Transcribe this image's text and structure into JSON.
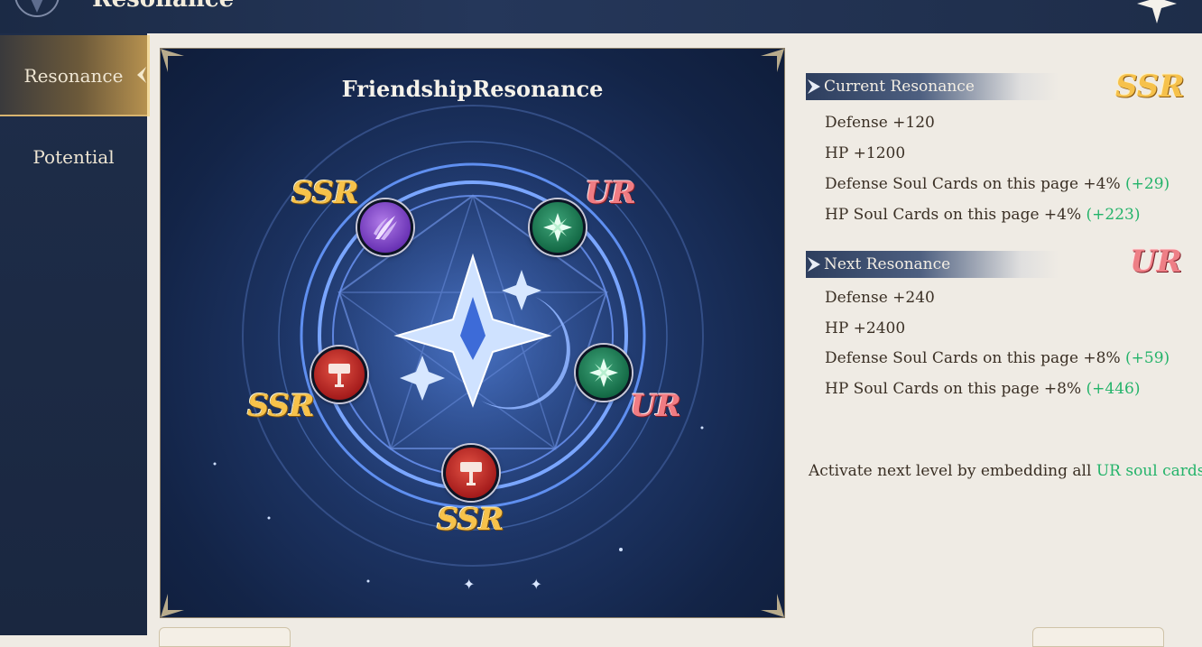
{
  "header": {
    "title": "Resonance",
    "close_icon": "star-close-icon"
  },
  "sidebar": {
    "items": [
      {
        "label": "Resonance",
        "active": true
      },
      {
        "label": "Potential",
        "active": false
      }
    ]
  },
  "card": {
    "title": "FriendshipResonance",
    "nodes": [
      {
        "rank": "SSR",
        "icon": "claw-icon",
        "color": "purple"
      },
      {
        "rank": "UR",
        "icon": "compass-star-icon",
        "color": "green"
      },
      {
        "rank": "UR",
        "icon": "compass-star-icon",
        "color": "green"
      },
      {
        "rank": "SSR",
        "icon": "hammer-icon",
        "color": "red"
      },
      {
        "rank": "SSR",
        "icon": "hammer-icon",
        "color": "red"
      }
    ],
    "page_dots": "✦ ✦"
  },
  "current": {
    "label": "Current Resonance",
    "rank": "SSR",
    "stats": [
      {
        "text": "Defense +120",
        "bonus": ""
      },
      {
        "text": "HP +1200",
        "bonus": ""
      },
      {
        "text": "Defense Soul Cards on this page +4%",
        "bonus": "(+29)"
      },
      {
        "text": "HP Soul Cards on this page +4%",
        "bonus": "(+223)"
      }
    ]
  },
  "next": {
    "label": "Next Resonance",
    "rank": "UR",
    "stats": [
      {
        "text": "Defense +240",
        "bonus": ""
      },
      {
        "text": "HP +2400",
        "bonus": ""
      },
      {
        "text": "Defense Soul Cards on this page +8%",
        "bonus": "(+59)"
      },
      {
        "text": "HP Soul Cards on this page +8%",
        "bonus": "(+446)"
      }
    ]
  },
  "note": {
    "prefix": "Activate next level by embedding all ",
    "highlight": "UR soul cards"
  },
  "colors": {
    "bonus_green": "#24b36a",
    "ssr_gold": "#f7c24a",
    "ur_pink": "#f07c83"
  }
}
